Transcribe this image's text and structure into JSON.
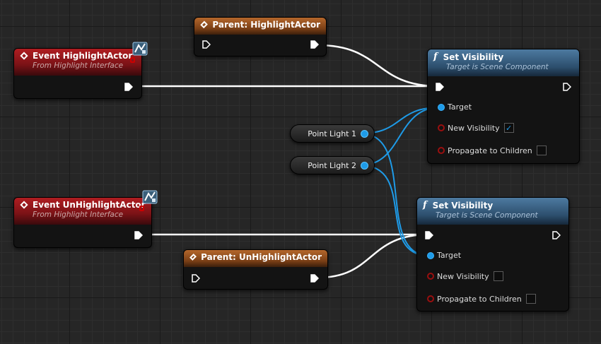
{
  "nodes": {
    "parent_highlight": {
      "title": "Parent: HighlightActor"
    },
    "event_highlight": {
      "title": "Event HighlightActor",
      "subtitle": "From Highlight Interface"
    },
    "event_unhighlight": {
      "title": "Event UnHighlightActor",
      "subtitle": "From Highlight Interface"
    },
    "parent_unhighlight": {
      "title": "Parent: UnHighlightActor"
    },
    "set_vis_1": {
      "title": "Set Visibility",
      "subtitle": "Target is Scene Component",
      "target": "Target",
      "new_visibility": "New Visibility",
      "new_visibility_checked": "✓",
      "propagate": "Propagate to Children"
    },
    "set_vis_2": {
      "title": "Set Visibility",
      "subtitle": "Target is Scene Component",
      "target": "Target",
      "new_visibility": "New Visibility",
      "new_visibility_checked": "",
      "propagate": "Propagate to Children"
    }
  },
  "variables": {
    "point_light_1": "Point Light 1",
    "point_light_2": "Point Light 2"
  },
  "colors": {
    "event_header": "#b01d21",
    "parent_header": "#b5672b",
    "function_header": "#4d7aa0",
    "object_pin": "#1e9be8",
    "bool_pin": "#9a0f0f",
    "exec_wire": "#ffffff"
  },
  "icons": {
    "event": "diamond-icon",
    "function": "function-icon",
    "interface_badge": "interface-icon"
  }
}
